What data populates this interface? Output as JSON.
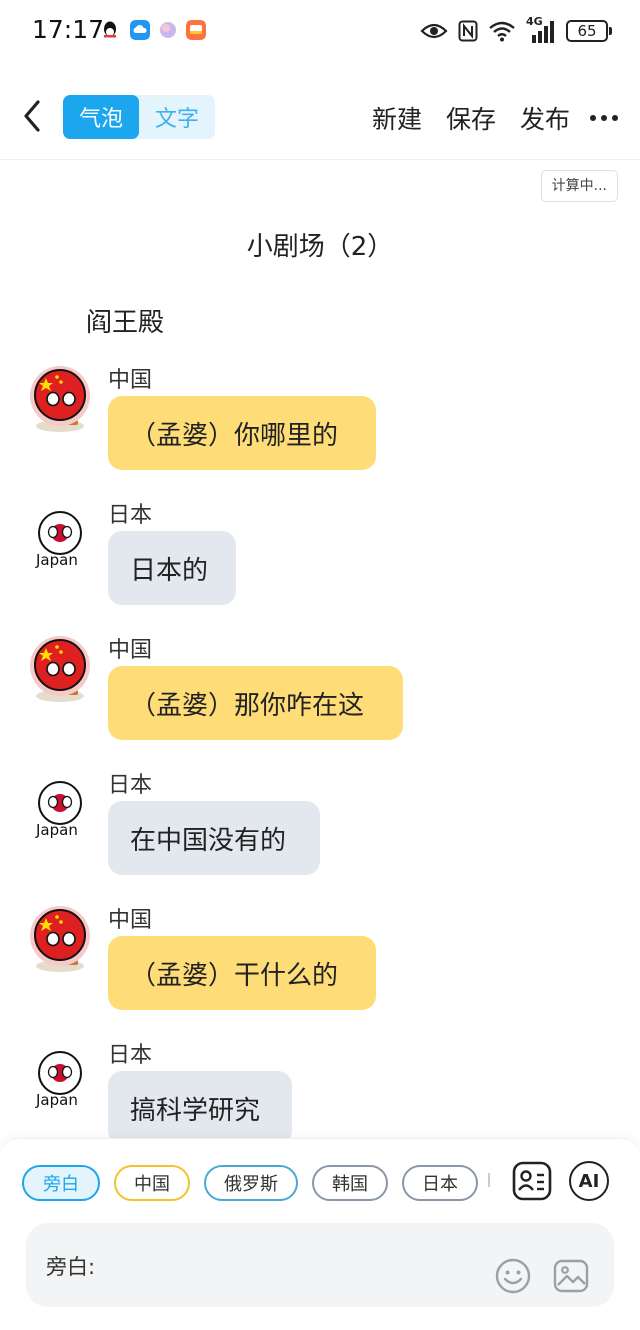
{
  "status": {
    "time": "17:17",
    "network": "4G",
    "battery": "65"
  },
  "nav": {
    "tabs": [
      "气泡",
      "文字"
    ],
    "actions": [
      "新建",
      "保存",
      "发布"
    ]
  },
  "calc_label": "计算中...",
  "title": "小剧场（2）",
  "scene": "阎王殿",
  "avatar_labels": {
    "japan": "Japan"
  },
  "messages": [
    {
      "speaker": "中国",
      "text": "（孟婆）你哪里的"
    },
    {
      "speaker": "日本",
      "text": "日本的"
    },
    {
      "speaker": "中国",
      "text": "（孟婆）那你咋在这"
    },
    {
      "speaker": "日本",
      "text": "在中国没有的"
    },
    {
      "speaker": "中国",
      "text": "（孟婆）干什么的"
    },
    {
      "speaker": "日本",
      "text": "搞科学研究"
    }
  ],
  "roles": [
    "旁白",
    "中国",
    "俄罗斯",
    "韩国",
    "日本"
  ],
  "ai_label": "AI",
  "input": {
    "label": "旁白:",
    "value": ""
  },
  "colors": {
    "accent": "#1ba6ee",
    "yellow_bubble": "#fedc78",
    "grey_bubble": "#e3e8ef",
    "chip_china": "#f2c230",
    "chip_russia": "#4aa8d8",
    "chip_korea": "#8a97a8",
    "chip_japan": "#8a97a8"
  }
}
